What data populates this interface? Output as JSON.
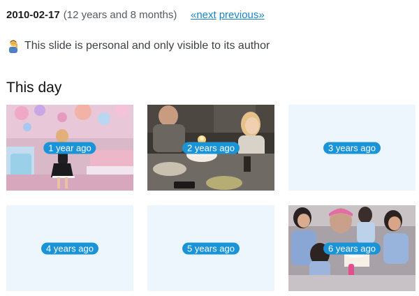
{
  "header": {
    "date": "2010-02-17",
    "age": "(12 years and 8 months)",
    "next_label": "«next",
    "previous_label": "previous»"
  },
  "notice": {
    "icon": "person-facepalm-icon",
    "text": "This slide is personal and only visible to its author"
  },
  "section": {
    "title": "This day"
  },
  "tiles": [
    {
      "label": "1 year ago",
      "has_photo": true,
      "photo": "girl-in-colorful-decorated-room"
    },
    {
      "label": "2 years ago",
      "has_photo": true,
      "photo": "birthday-cake-with-candles-at-table"
    },
    {
      "label": "3 years ago",
      "has_photo": false
    },
    {
      "label": "4 years ago",
      "has_photo": false
    },
    {
      "label": "5 years ago",
      "has_photo": false
    },
    {
      "label": "6 years ago",
      "has_photo": true,
      "photo": "children-around-birthday-cake"
    }
  ],
  "colors": {
    "link": "#1a84c8",
    "badge": "#1a94d6",
    "empty_tile": "#eef6fd"
  }
}
